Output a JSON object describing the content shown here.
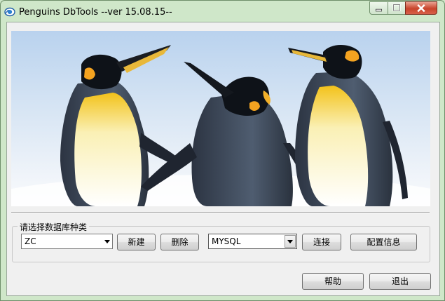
{
  "window": {
    "title": "Penguins DbTools --ver 15.08.15--",
    "icon": "penguin-eye-icon",
    "controls": {
      "minimize": "minimize-icon",
      "maximize": "maximize-icon",
      "close": "close-icon"
    }
  },
  "group": {
    "title": "请选择数据库种类",
    "connection_select": {
      "value": "ZC"
    },
    "new_label": "新建",
    "delete_label": "删除",
    "db_type_select": {
      "value": "MYSQL"
    },
    "connect_label": "连接",
    "config_label": "配置信息"
  },
  "footer": {
    "help_label": "帮助",
    "exit_label": "退出"
  }
}
